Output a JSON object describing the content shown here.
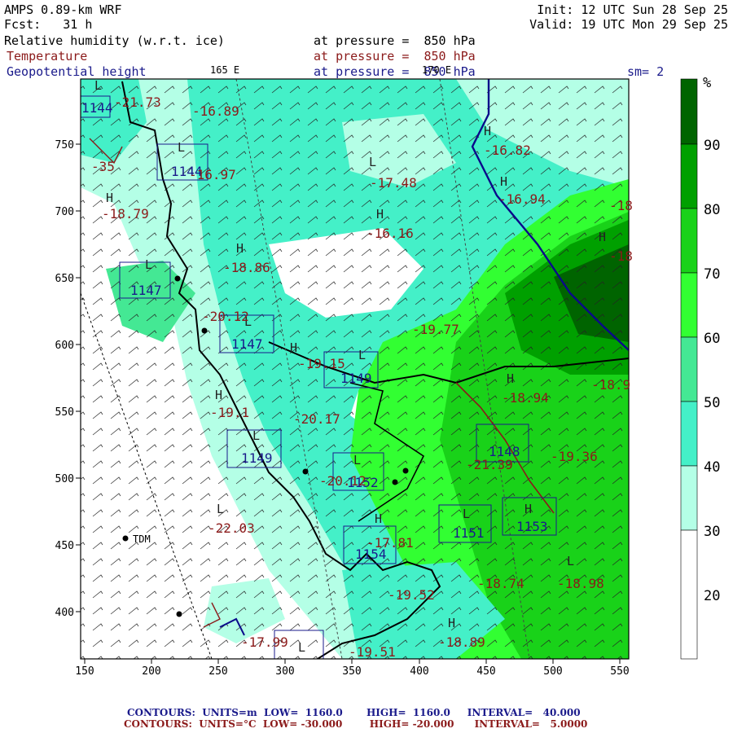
{
  "header": {
    "model": "AMPS 0.89-km WRF",
    "fcst_label": "Fcst:",
    "fcst_value": "31 h",
    "init": "Init: 12 UTC Sun 28 Sep 25",
    "valid": "Valid: 19 UTC Mon 29 Sep 25",
    "fields": [
      {
        "name": "Relative humidity (w.r.t. ice)",
        "level": "at pressure =  850 hPa"
      },
      {
        "name": "Temperature",
        "level": "at pressure =  850 hPa"
      },
      {
        "name": "Geopotential height",
        "level": "at pressure =  850 hPa"
      }
    ],
    "lon_label_1": "165 E",
    "lon_label_2": "170 E",
    "smoothing": "sm= 2"
  },
  "axes": {
    "x_ticks": [
      "150",
      "200",
      "250",
      "300",
      "350",
      "400",
      "450",
      "500",
      "550"
    ],
    "y_ticks": [
      "750",
      "700",
      "650",
      "600",
      "550",
      "500",
      "450",
      "400"
    ]
  },
  "colorbar": {
    "unit": "%",
    "levels": [
      "90",
      "80",
      "70",
      "60",
      "50",
      "40",
      "30",
      "20"
    ],
    "colors": [
      "#006400",
      "#00a000",
      "#19d219",
      "#32ff32",
      "#44e894",
      "#44f0c8",
      "#b4ffe6",
      "#ffffff"
    ]
  },
  "station": "TDM",
  "height_labels": [
    "1144",
    "1144",
    "1147",
    "1147",
    "1149",
    "1149",
    "1152",
    "1154",
    "1151",
    "1153",
    "1148"
  ],
  "temp_labels": [
    "-16.89",
    "-16.97",
    "-18.79",
    "-18.86",
    "-20.12",
    "-19.15",
    "-19.1",
    "-20.17",
    "-20.12",
    "-22.03",
    "-17.81",
    "-19.52",
    "-17.99",
    "-19.51",
    "-18.89",
    "-18.74",
    "-18.98",
    "-17.48",
    "-16.16",
    "-19.77",
    "-16.82",
    "-16.94",
    "-18.94",
    "-19.36",
    "-21.39",
    "-18.9",
    "-18",
    "-18",
    "-35",
    "-21.73"
  ],
  "footer": {
    "line1": {
      "label": "CONTOURS:",
      "units": "UNITS=m",
      "low": "LOW=  1160.0",
      "high": "HIGH=  1160.0",
      "interval": "INTERVAL=   40.000"
    },
    "line2": {
      "label": "CONTOURS:",
      "units": "UNITS=°C",
      "low": "LOW= -30.000",
      "high": "HIGH= -20.000",
      "interval": "INTERVAL=   5.0000"
    }
  }
}
